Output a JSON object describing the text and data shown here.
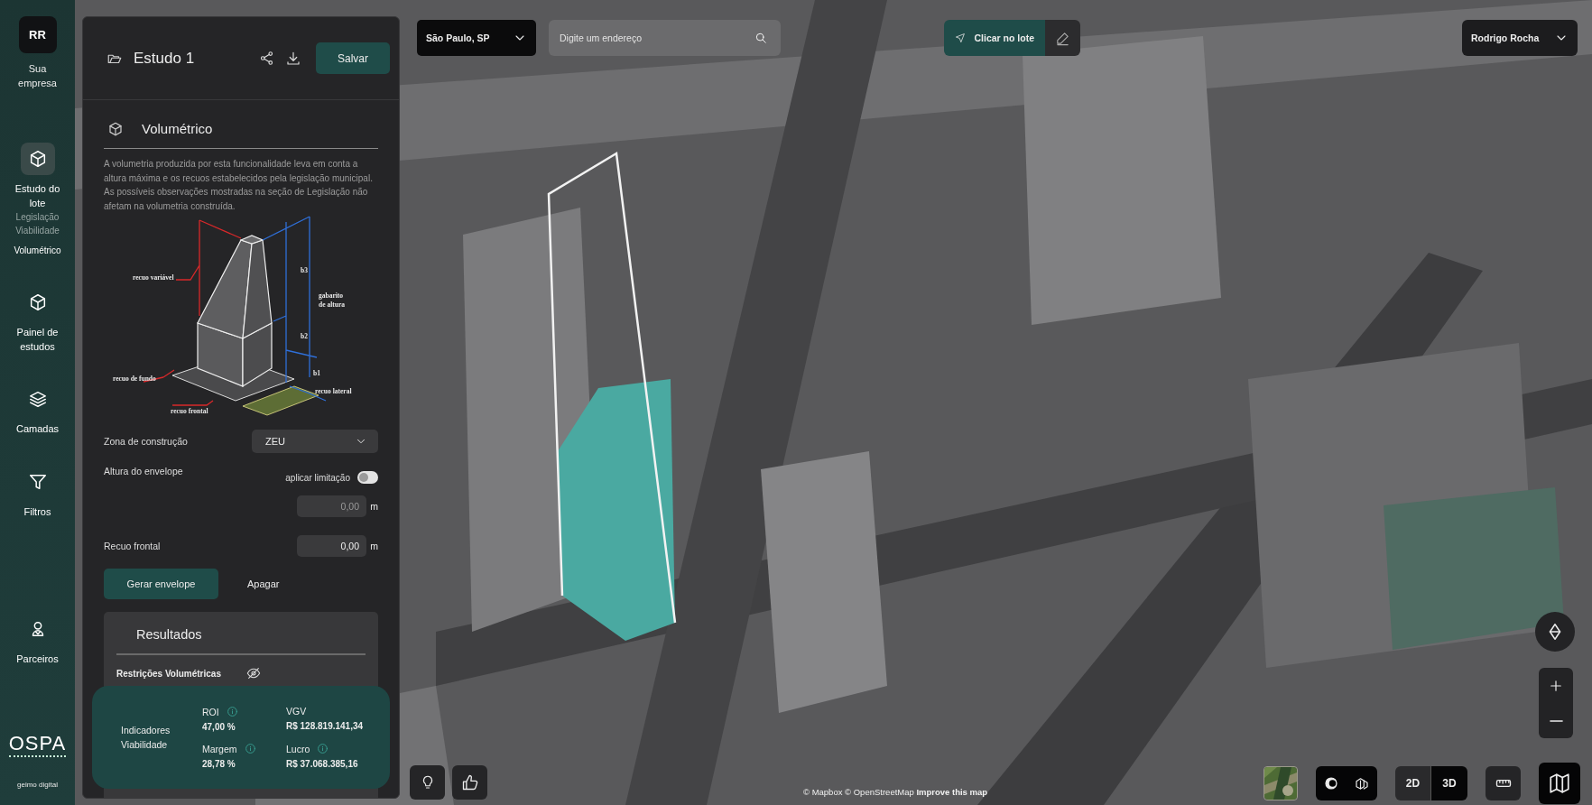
{
  "rail": {
    "avatar": "RR",
    "company": "Sua empresa",
    "items": [
      {
        "label": "Estudo do lote",
        "selected": true,
        "subitems": [
          {
            "label": "Legislação",
            "selected": false
          },
          {
            "label": "Viabilidade",
            "selected": false
          },
          {
            "label": "Volumétrico",
            "selected": true
          }
        ]
      },
      {
        "label": "Painel de estudos",
        "selected": false
      },
      {
        "label": "Camadas",
        "selected": false
      },
      {
        "label": "Filtros",
        "selected": false
      }
    ],
    "bottom_items": [
      {
        "label": "Parceiros",
        "selected": false
      }
    ],
    "logo": "OSPA",
    "footer": "geimo digital"
  },
  "panel": {
    "title": "Estudo 1",
    "save_button": "Salvar",
    "section_title": "Volumétrico",
    "description": "A volumetria produzida por esta funcionalidade leva em conta a altura máxima e os recuos estabelecidos pela legislação municipal. As possíveis observações mostradas na seção de Legislação não afetam na volumetria construída.",
    "diagram_labels": [
      "recuo variável",
      "b3",
      "gabarito",
      "de altura",
      "b2",
      "b1",
      "recuo de fundo",
      "recuo lateral",
      "recuo frontal"
    ],
    "fields": [
      {
        "kind": "select",
        "label": "Zona de construção",
        "value": "ZEU"
      },
      {
        "kind": "toggle_input",
        "label": "Altura do envelope",
        "toggle_label": "aplicar limitação",
        "on": false,
        "placeholder": "0,00",
        "unit": "m"
      },
      {
        "kind": "input",
        "label": "Recuo frontal",
        "value": "0,00",
        "unit": "m"
      }
    ],
    "primary_action": "Gerar envelope",
    "secondary_action": "Apagar",
    "results": {
      "title": "Resultados",
      "rows": [
        {
          "label": "Restrições Volumétricas"
        }
      ]
    },
    "indicators": {
      "title": "Indicadores Viabilidade",
      "items": [
        {
          "label": "ROI",
          "value": "47,00 %",
          "info": true
        },
        {
          "label": "VGV",
          "value": "R$ 128.819.141,34",
          "info": false
        },
        {
          "label": "Margem",
          "value": "28,78 %",
          "info": true
        },
        {
          "label": "Lucro",
          "value": "R$ 37.068.385,16",
          "info": true
        }
      ]
    }
  },
  "map": {
    "city": "São Paulo, SP",
    "search_placeholder": "Digite um endereço",
    "pick_button": "Clicar no lote",
    "user": "Rodrigo Rocha",
    "view_modes": [
      {
        "label": "2D",
        "selected": false
      },
      {
        "label": "3D",
        "selected": true
      }
    ],
    "attribution": "© Mapbox © OpenStreetMap **Improve this map**"
  }
}
